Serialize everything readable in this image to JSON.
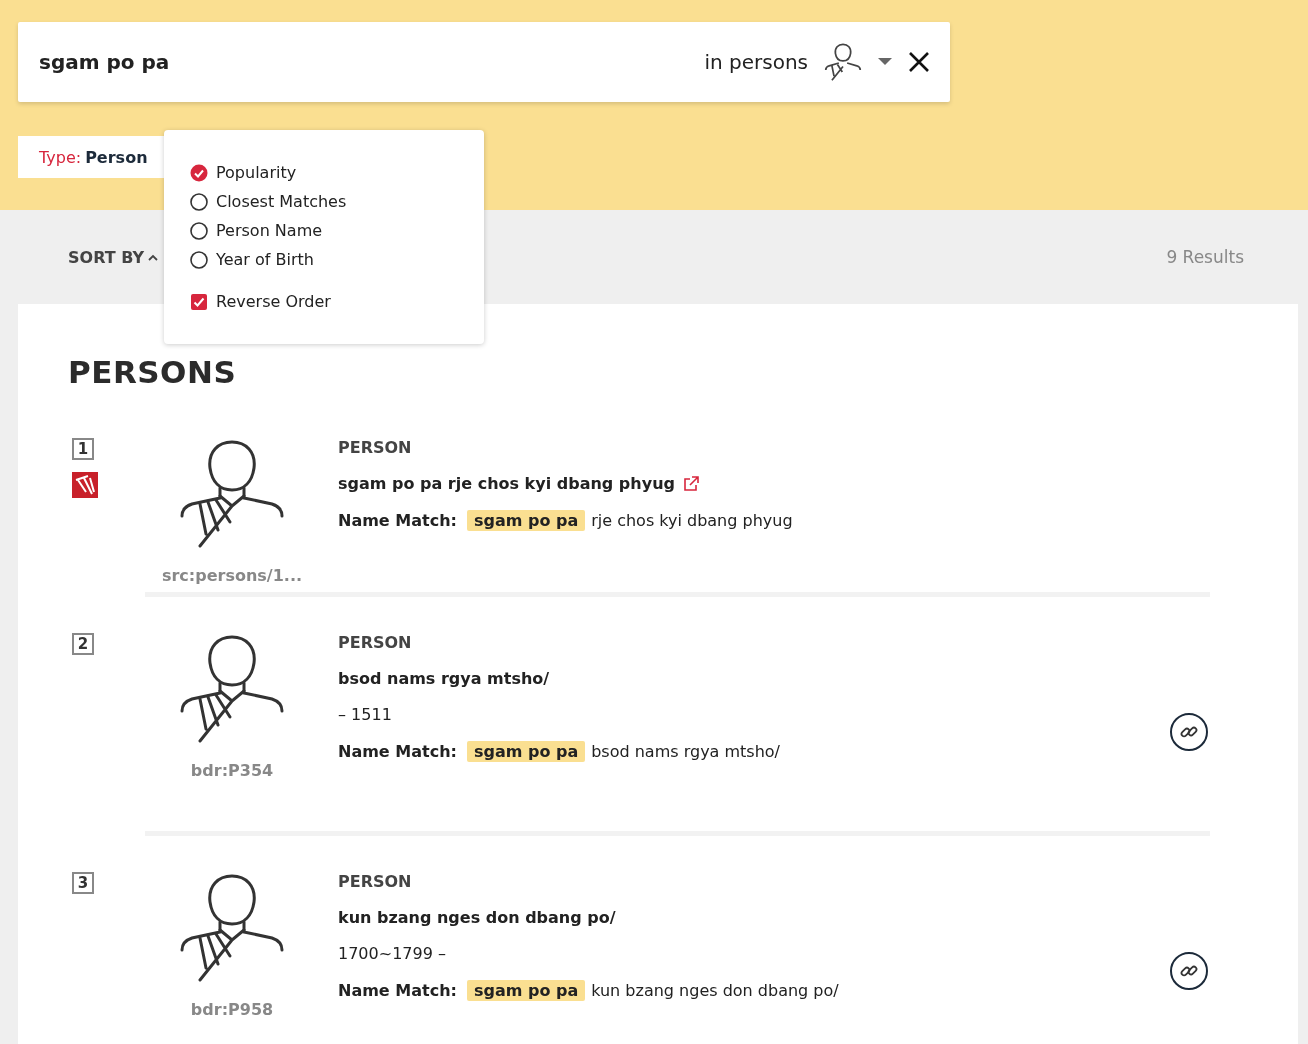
{
  "search": {
    "query": "sgam po pa",
    "scope": "in persons"
  },
  "filter": {
    "label": "Type:",
    "value": "Person"
  },
  "sort": {
    "label": "SORT BY",
    "expanded": true,
    "options": [
      {
        "label": "Popularity",
        "selected": true
      },
      {
        "label": "Closest Matches",
        "selected": false
      },
      {
        "label": "Person Name",
        "selected": false
      },
      {
        "label": "Year of Birth",
        "selected": false
      }
    ],
    "reverse": {
      "label": "Reverse Order",
      "checked": true
    }
  },
  "results_count": "9 Results",
  "section_title": "PERSONS",
  "results": [
    {
      "index": "1",
      "source_logo": true,
      "id": "src:persons/1...",
      "type": "PERSON",
      "title": "sgam po pa rje chos kyi dbang phyug",
      "external_link": true,
      "match_label": "Name Match:",
      "match": "sgam po pa",
      "rest": "rje chos kyi dbang phyug",
      "permalink": false
    },
    {
      "index": "2",
      "source_logo": false,
      "id": "bdr:P354",
      "type": "PERSON",
      "title": "bsod nams rgya mtsho/",
      "external_link": false,
      "dates": "– 1511",
      "match_label": "Name Match:",
      "match": "sgam po pa",
      "rest": "bsod nams rgya mtsho/",
      "permalink": true
    },
    {
      "index": "3",
      "source_logo": false,
      "id": "bdr:P958",
      "type": "PERSON",
      "title": "kun bzang nges don dbang po/",
      "external_link": false,
      "dates": "1700~1799 –",
      "match_label": "Name Match:",
      "match": "sgam po pa",
      "rest": "kun bzang nges don dbang po/",
      "permalink": true
    }
  ]
}
